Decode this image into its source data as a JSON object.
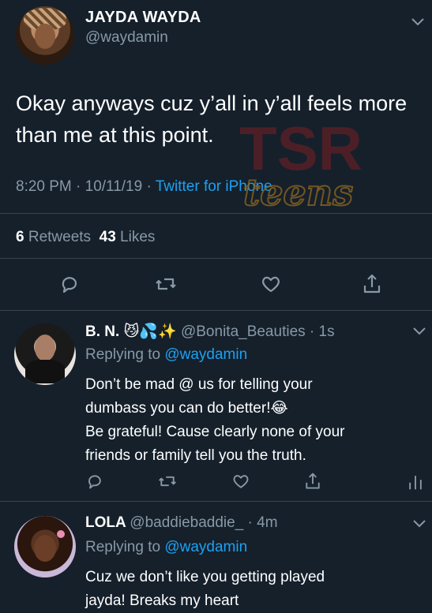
{
  "main_tweet": {
    "name": "JAYDA WAYDA",
    "handle": "@waydamin",
    "text": "Okay anyways cuz y’all in y’all feels more than me at this point.",
    "time": "8:20 PM · 10/11/19 · ",
    "source": "Twitter for iPhone",
    "retweets_count": "6",
    "retweets_label": "Retweets",
    "likes_count": "43",
    "likes_label": "Likes"
  },
  "watermark": {
    "letters": "TSR",
    "word": "teens"
  },
  "replies": [
    {
      "name": "B. N.",
      "emoji": "😼💦✨",
      "handle": "@Bonita_Beauties",
      "time": "· 1s",
      "replying_prefix": "Replying to ",
      "replying_to": "@waydamin",
      "text_line1": "Don’t be mad @ us for telling your",
      "text_line2": "dumbass you can do better!😂",
      "text_line3": "Be grateful! Cause clearly none of your",
      "text_line4": "friends or family tell you the truth."
    },
    {
      "name": "LOLA",
      "emoji": "",
      "handle": "@baddiebaddie_",
      "time": "· 4m",
      "replying_prefix": "Replying to ",
      "replying_to": "@waydamin",
      "text_line1": "Cuz we don’t like you getting played",
      "text_line2": "jayda!  Breaks my heart"
    }
  ],
  "icons": [
    "reply-icon",
    "retweet-icon",
    "like-icon",
    "share-icon",
    "analytics-icon",
    "chevron-down-icon"
  ],
  "colors": {
    "background": "#15202b",
    "accent": "#1da1f2",
    "muted": "#8899a6",
    "divider": "#38444d"
  }
}
